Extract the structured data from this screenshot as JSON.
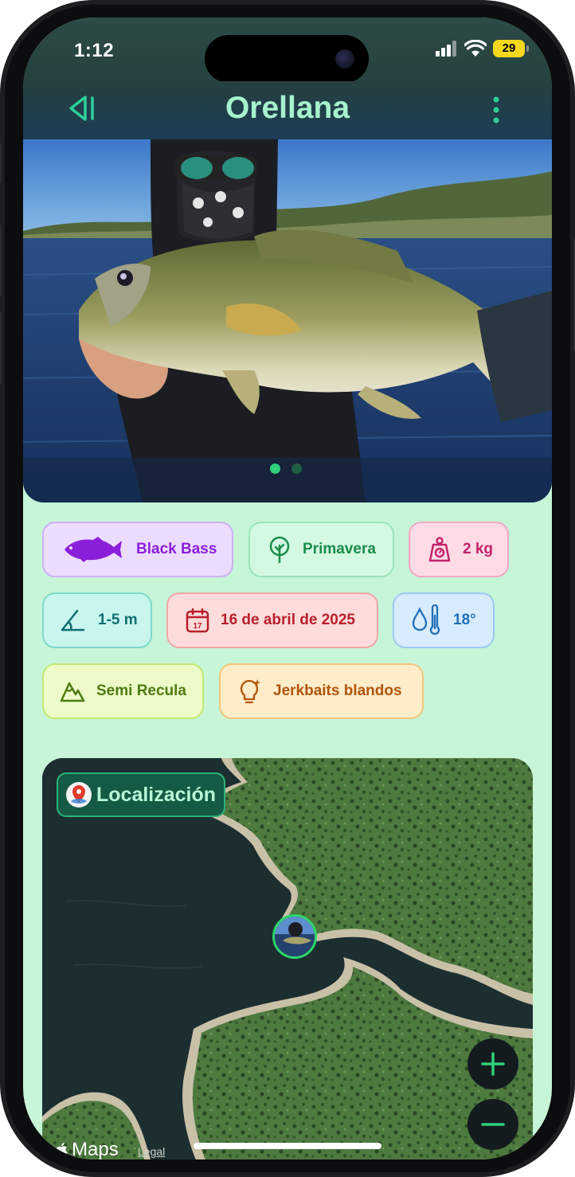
{
  "status_bar": {
    "time": "1:12",
    "battery": "29",
    "icons": [
      "cellular-signal-icon",
      "wifi-icon",
      "battery-icon"
    ]
  },
  "nav": {
    "title": "Orellana",
    "back_icon": "back-icon",
    "more_icon": "more-vertical-icon",
    "accent": "#a6f2cd"
  },
  "gallery": {
    "photo_count": 2,
    "current_index": 1
  },
  "chips": {
    "species": {
      "label": "Black Bass",
      "icon": "fish-icon",
      "color": "#8a1fd9"
    },
    "season": {
      "label": "Primavera",
      "icon": "tree-icon",
      "color": "#1a8c4a"
    },
    "weight": {
      "label": "2 kg",
      "icon": "scale-icon",
      "color": "#c3236a"
    },
    "depth": {
      "label": "1-5 m",
      "icon": "angle-icon",
      "color": "#0f6e6e"
    },
    "date": {
      "label": "16 de abril de 2025",
      "icon": "calendar-icon",
      "icon_text": "17",
      "color": "#b8202c"
    },
    "water_temp": {
      "label": "18°",
      "icon": "water-temperature-icon",
      "color": "#1f6fb8"
    },
    "structure": {
      "label": "Semi Recula",
      "icon": "mountain-icon",
      "color": "#4f7a12"
    },
    "lure": {
      "label": "Jerkbaits blandos",
      "icon": "lightbulb-icon",
      "color": "#b0560c"
    }
  },
  "map": {
    "label": "Localización",
    "attribution": "Maps",
    "legal": "Legal",
    "zoom_in": "+",
    "zoom_out": "−"
  }
}
